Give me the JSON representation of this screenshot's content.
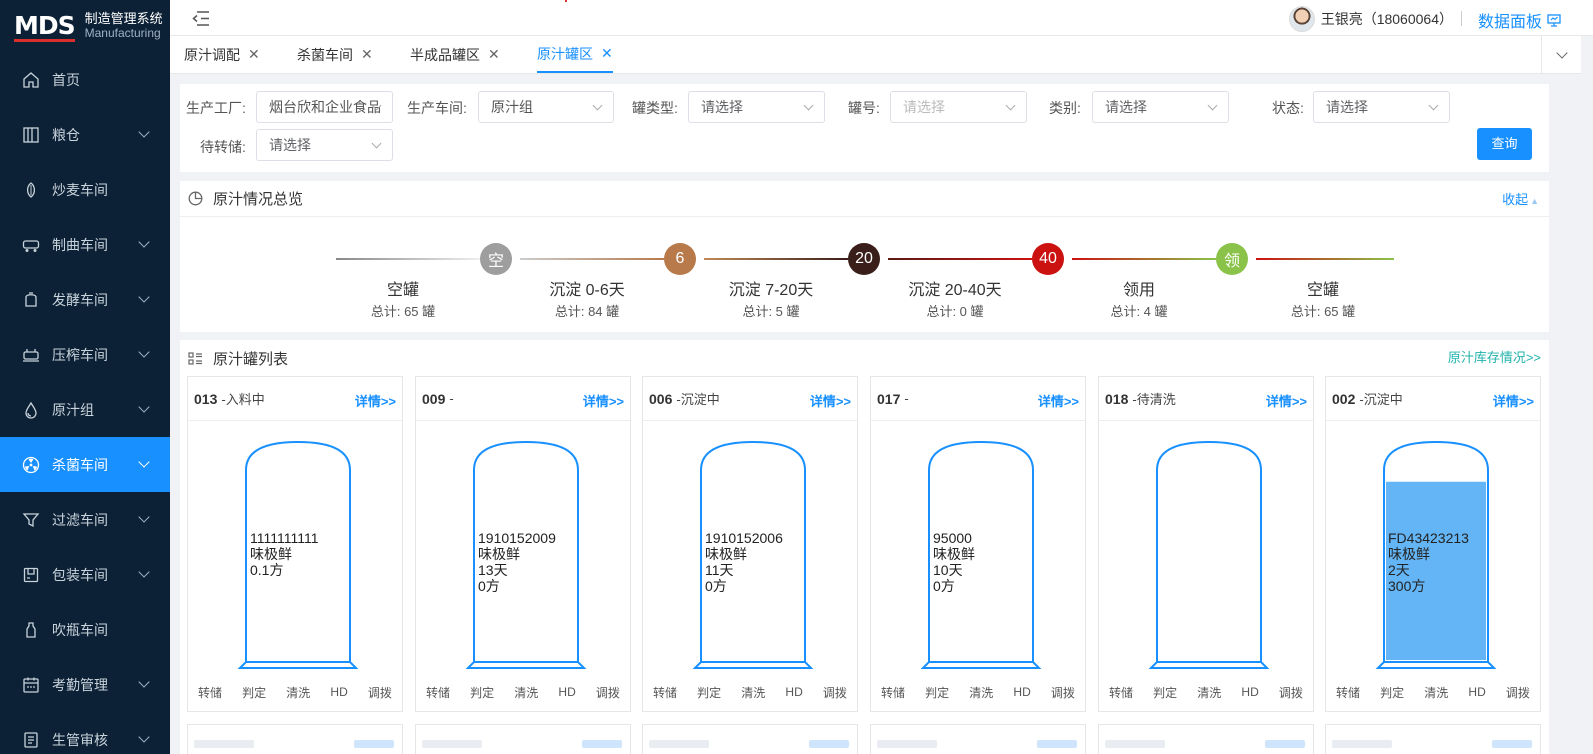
{
  "app": {
    "logo_text": "MDS",
    "title": "制造管理系统",
    "subtitle": "Manufacturing"
  },
  "sidebar": {
    "items": [
      {
        "label": "首页",
        "icon": "home-icon",
        "has_children": false,
        "active": false
      },
      {
        "label": "粮仓",
        "icon": "granary-icon",
        "has_children": true,
        "active": false
      },
      {
        "label": "炒麦车间",
        "icon": "seed-icon",
        "has_children": false,
        "active": false
      },
      {
        "label": "制曲车间",
        "icon": "conveyor-icon",
        "has_children": true,
        "active": false
      },
      {
        "label": "发酵车间",
        "icon": "tank-icon",
        "has_children": true,
        "active": false
      },
      {
        "label": "压榨车间",
        "icon": "press-icon",
        "has_children": true,
        "active": false
      },
      {
        "label": "原汁组",
        "icon": "droplet-icon",
        "has_children": true,
        "active": false
      },
      {
        "label": "杀菌车间",
        "icon": "radiation-icon",
        "has_children": true,
        "active": true
      },
      {
        "label": "过滤车间",
        "icon": "filter-icon",
        "has_children": true,
        "active": false
      },
      {
        "label": "包装车间",
        "icon": "package-icon",
        "has_children": true,
        "active": false
      },
      {
        "label": "吹瓶车间",
        "icon": "bottle-icon",
        "has_children": false,
        "active": false
      },
      {
        "label": "考勤管理",
        "icon": "calendar-icon",
        "has_children": true,
        "active": false
      },
      {
        "label": "生管审核",
        "icon": "audit-icon",
        "has_children": true,
        "active": false
      }
    ]
  },
  "header": {
    "user": "王银亮（18060064）",
    "dashboard_label": "数据面板"
  },
  "tabs": [
    {
      "label": "原汁调配",
      "active": false
    },
    {
      "label": "杀菌车间",
      "active": false
    },
    {
      "label": "半成品罐区",
      "active": false
    },
    {
      "label": "原汁罐区",
      "active": true
    }
  ],
  "filters": {
    "factory_label": "生产工厂:",
    "factory_value": "烟台欣和企业食品",
    "workshop_label": "生产车间:",
    "workshop_value": "原汁组",
    "tank_type_label": "罐类型:",
    "tank_type_value": "请选择",
    "tank_no_label": "罐号:",
    "tank_no_value": "请选择",
    "category_label": "类别:",
    "category_value": "请选择",
    "status_label": "状态:",
    "status_value": "请选择",
    "pending_label": "待转储:",
    "pending_value": "请选择",
    "query_button": "查询"
  },
  "overview": {
    "title": "原汁情况总览",
    "collapse_label": "收起",
    "stages": [
      {
        "badge": "空",
        "name": "空罐",
        "count": "总计: 65 罐",
        "color": "#9e9e9e"
      },
      {
        "badge": "6",
        "name": "沉淀 0-6天",
        "count": "总计: 84 罐",
        "color": "#b87a4b"
      },
      {
        "badge": "20",
        "name": "沉淀 7-20天",
        "count": "总计: 5 罐",
        "color": "#3a1e1a"
      },
      {
        "badge": "40",
        "name": "沉淀 20-40天",
        "count": "总计: 0 罐",
        "color": "#cc1111"
      },
      {
        "badge": "领",
        "name": "领用",
        "count": "总计: 4 罐",
        "color": "#8bc34a"
      }
    ],
    "final_stage": {
      "name": "空罐",
      "count": "总计: 65 罐"
    }
  },
  "tank_list": {
    "title": "原汁罐列表",
    "stock_link": "原汁库存情况>>",
    "detail_label": "详情>>",
    "actions": [
      "转储",
      "判定",
      "清洗",
      "HD",
      "调拨"
    ],
    "tanks": [
      {
        "no": "013",
        "status": "-入料中",
        "batch": "1111111111",
        "product": "味极鲜",
        "days": "",
        "volume": "0.1方",
        "fill": 0
      },
      {
        "no": "009",
        "status": "-",
        "batch": "1910152009",
        "product": "味极鲜",
        "days": "13天",
        "volume": "0方",
        "fill": 0
      },
      {
        "no": "006",
        "status": "-沉淀中",
        "batch": "1910152006",
        "product": "味极鲜",
        "days": "11天",
        "volume": "0方",
        "fill": 0
      },
      {
        "no": "017",
        "status": "-",
        "batch": "95000",
        "product": "味极鲜",
        "days": "10天",
        "volume": "0方",
        "fill": 0
      },
      {
        "no": "018",
        "status": "-待清洗",
        "batch": "",
        "product": "",
        "days": "",
        "volume": "",
        "fill": 0
      },
      {
        "no": "002",
        "status": "-沉淀中",
        "batch": "FD43423213",
        "product": "味极鲜",
        "days": "2天",
        "volume": "300方",
        "fill": 0.92
      }
    ]
  },
  "colors": {
    "sidebar_bg": "#0c2135",
    "accent": "#1890ff",
    "tank_stroke": "#1890ff",
    "tank_fill": "#64b5f6",
    "stock_link": "#20b2aa"
  }
}
